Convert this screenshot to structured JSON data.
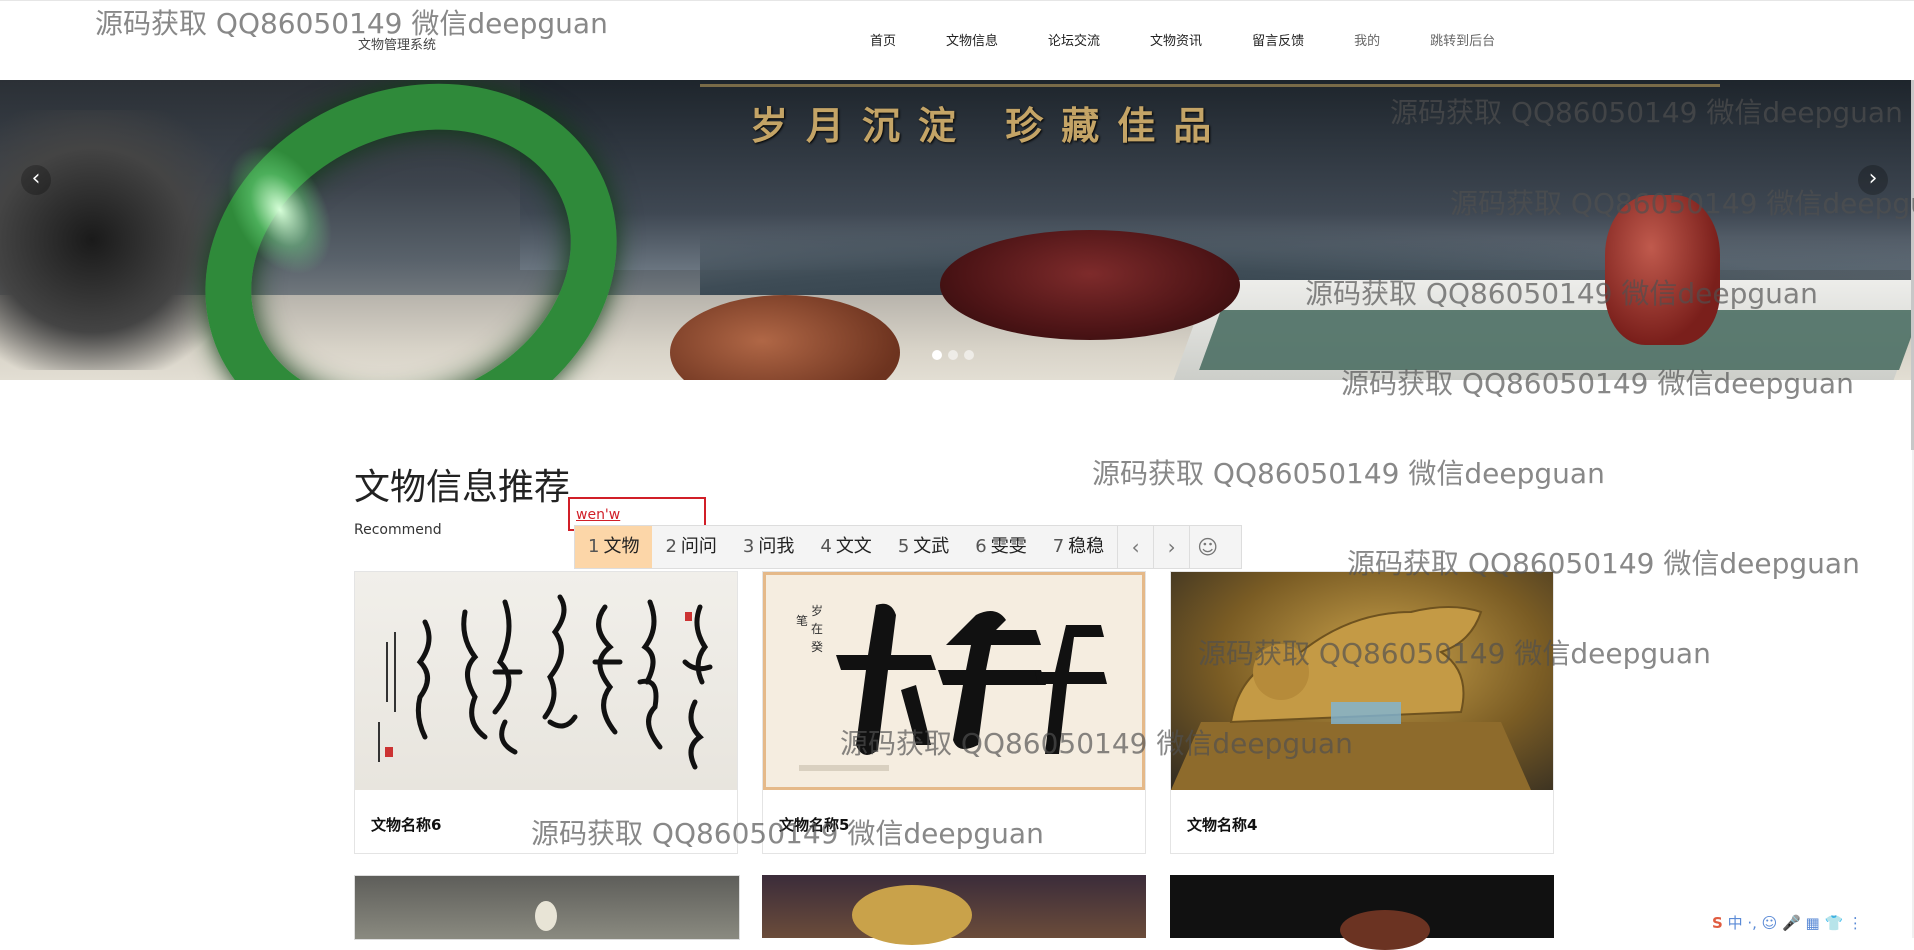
{
  "header": {
    "site_title": "文物管理系统",
    "nav": [
      "首页",
      "文物信息",
      "论坛交流",
      "文物资讯",
      "留言反馈",
      "我的",
      "跳转到后台"
    ]
  },
  "banner": {
    "slogan": "岁月沉淀 珍藏佳品",
    "prev_icon": "‹",
    "next_icon": "›",
    "slide_count": 3,
    "active_slide": 1
  },
  "section": {
    "title": "文物信息推荐",
    "subtitle": "Recommend"
  },
  "ime": {
    "composition": "wen'w",
    "candidates": [
      {
        "num": "1",
        "text": "文物"
      },
      {
        "num": "2",
        "text": "问问"
      },
      {
        "num": "3",
        "text": "问我"
      },
      {
        "num": "4",
        "text": "文文"
      },
      {
        "num": "5",
        "text": "文武"
      },
      {
        "num": "6",
        "text": "雯雯"
      },
      {
        "num": "7",
        "text": "稳稳"
      }
    ],
    "prev_icon": "‹",
    "next_icon": "›",
    "emoji_icon": "☺"
  },
  "cards": [
    {
      "name": "文物名称6"
    },
    {
      "name": "文物名称5"
    },
    {
      "name": "文物名称4"
    }
  ],
  "watermark": "源码获取 QQ86050149 微信deepguan",
  "tray": "中 ·, ☺ 🎤 ▦ 👕 ⋮"
}
